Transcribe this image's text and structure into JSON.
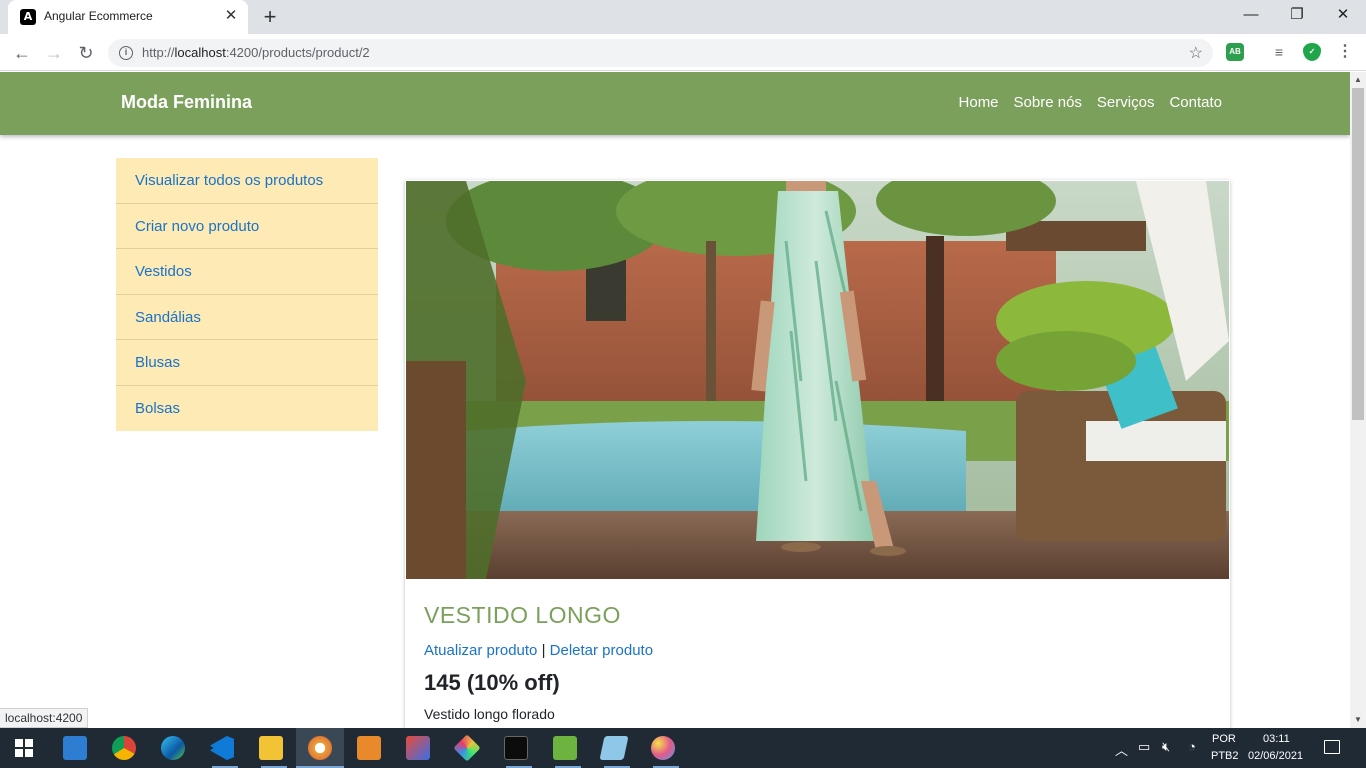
{
  "browser": {
    "tab_title": "Angular Ecommerce",
    "tab_close": "✕",
    "new_tab": "+",
    "url_prefix": "http://",
    "url_host": "localhost",
    "url_path": ":4200/products/product/2",
    "status_link": "localhost:4200",
    "window_buttons": {
      "minimize": "—",
      "maximize": "❐",
      "close": "✕"
    }
  },
  "navbar": {
    "brand": "Moda Feminina",
    "links": [
      "Home",
      "Sobre nós",
      "Serviços",
      "Contato"
    ]
  },
  "sidebar": {
    "items": [
      {
        "label": "Visualizar todos os produtos"
      },
      {
        "label": "Criar novo produto"
      },
      {
        "label": "Vestidos"
      },
      {
        "label": "Sandálias"
      },
      {
        "label": "Blusas"
      },
      {
        "label": "Bolsas"
      }
    ]
  },
  "product": {
    "title": "VESTIDO LONGO",
    "update_label": "Atualizar produto",
    "separator": "|",
    "delete_label": "Deletar produto",
    "price": "145 (10% off)",
    "description": "Vestido longo florado"
  },
  "taskbar": {
    "language": "POR",
    "layout": "PTB2",
    "time": "03:11",
    "date": "02/06/2021"
  },
  "colors": {
    "navbar": "#7ba05b",
    "sidebar": "#fdeab5",
    "link": "#1a73c8",
    "title": "#7ba05b"
  }
}
